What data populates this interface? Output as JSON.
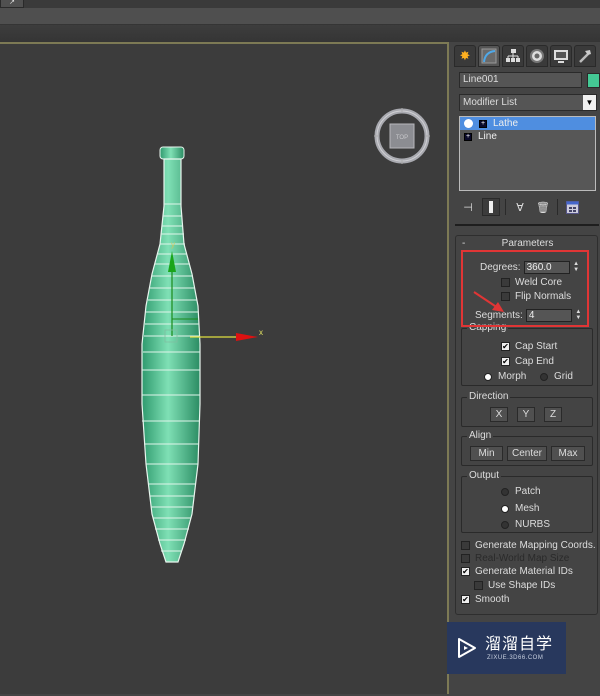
{
  "toolbar": {
    "pin_glyph": "↗"
  },
  "viewport": {
    "viewcube_label": "TOP",
    "gizmo": {
      "x_label": "x",
      "y_label": "y"
    },
    "model_color": "#4fc996",
    "border_color": "#7d7a55"
  },
  "command_panel": {
    "tabs": [
      {
        "name": "create",
        "icon": "create-icon"
      },
      {
        "name": "modify",
        "icon": "modify-icon"
      },
      {
        "name": "hierarchy",
        "icon": "hierarchy-icon"
      },
      {
        "name": "motion",
        "icon": "motion-icon"
      },
      {
        "name": "display",
        "icon": "display-icon"
      },
      {
        "name": "utilities",
        "icon": "utilities-icon"
      }
    ],
    "object_name": "Line001",
    "object_color": "#44c995",
    "modifier_list_label": "Modifier List",
    "stack": [
      {
        "label": "Lathe",
        "selected": true
      },
      {
        "label": "Line",
        "selected": false
      }
    ]
  },
  "parameters": {
    "title": "Parameters",
    "collapse_glyph": "-",
    "degrees_label": "Degrees:",
    "degrees_value": "360.0",
    "weld_core_label": "Weld Core",
    "weld_core_checked": false,
    "flip_normals_label": "Flip Normals",
    "flip_normals_checked": false,
    "segments_label": "Segments:",
    "segments_value": "4",
    "capping": {
      "label": "Capping",
      "cap_start_label": "Cap Start",
      "cap_start_checked": true,
      "cap_end_label": "Cap End",
      "cap_end_checked": true,
      "morph_label": "Morph",
      "grid_label": "Grid",
      "selected": "Morph"
    },
    "direction": {
      "label": "Direction",
      "buttons": [
        "X",
        "Y",
        "Z"
      ]
    },
    "align": {
      "label": "Align",
      "buttons": [
        "Min",
        "Center",
        "Max"
      ]
    },
    "output": {
      "label": "Output",
      "options": [
        "Patch",
        "Mesh",
        "NURBS"
      ],
      "selected": "Mesh"
    },
    "gen_mapping_label": "Generate Mapping Coords.",
    "gen_mapping_checked": false,
    "real_world_label": "Real-World Map Size",
    "real_world_checked": false,
    "gen_material_ids_label": "Generate Material IDs",
    "gen_material_ids_checked": true,
    "use_shape_ids_label": "Use Shape IDs",
    "use_shape_ids_checked": false,
    "smooth_label": "Smooth",
    "smooth_checked": true
  },
  "annotation": {
    "highlight_color": "#e03535"
  },
  "watermark": {
    "title": "溜溜自学",
    "subtitle": "ZIXUE.3D66.COM",
    "bg_color": "#28385d"
  }
}
